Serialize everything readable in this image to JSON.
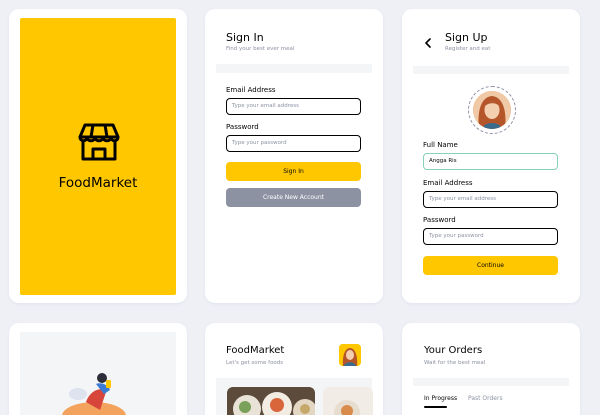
{
  "splash": {
    "title": "FoodMarket",
    "icon": "storefront-icon",
    "bg_color": "#ffc700"
  },
  "signin": {
    "title": "Sign In",
    "subtitle": "Find your best ever meal",
    "email_label": "Email Address",
    "email_placeholder": "Type your email address",
    "password_label": "Password",
    "password_placeholder": "Type your password",
    "signin_button": "Sign In",
    "create_account_button": "Create New Account"
  },
  "signup": {
    "title": "Sign Up",
    "subtitle": "Register and eat",
    "full_name_label": "Full Name",
    "full_name_value": "Angga Ris",
    "email_label": "Email Address",
    "email_placeholder": "Type your email address",
    "password_label": "Password",
    "password_placeholder": "Type your password",
    "continue_button": "Continue"
  },
  "home": {
    "title": "FoodMarket",
    "subtitle": "Let's get some foods"
  },
  "orders": {
    "title": "Your Orders",
    "subtitle": "Wait for the best meal",
    "tabs": [
      {
        "label": "In Progress"
      },
      {
        "label": "Past Orders"
      }
    ]
  },
  "colors": {
    "primary": "#ffc700",
    "gray": "#8d92a3",
    "text": "#020202",
    "focus": "#86d2b6"
  }
}
